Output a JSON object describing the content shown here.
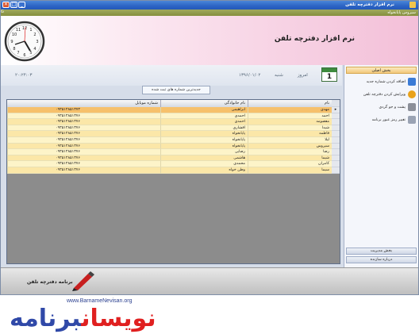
{
  "window": {
    "title": "نرم افزار دفترچه تلفن",
    "version_label": "G",
    "controls": {
      "close": "✕",
      "maximize": "□",
      "minimize": "_"
    }
  },
  "menubar": {
    "user_label": "سیروس پایانخواه"
  },
  "header": {
    "app_title": "نرم افزار دفترچه تلفن",
    "clock_icon": "clock-icon"
  },
  "infobar": {
    "calendar_day": "1",
    "today_label": "امروز",
    "weekday": "شنبه",
    "date": "۱۳۹۶/۰۱/۰۲",
    "time": "۲۰:۲۴:۰۳"
  },
  "notice": "جدیدترین شماره های ثبت شده",
  "grid": {
    "columns": [
      "نام",
      "نام خانوادگی",
      "شماره موبایل"
    ],
    "rows": [
      [
        "مهدی",
        "ابراهیمی",
        "۰۹۳۵۱۴۸۵۱۳۷۳"
      ],
      [
        "احمد",
        "احمدی",
        "۰۹۳۵۱۴۸۵۱۳۷۶"
      ],
      [
        "معصومه",
        "احمدی",
        "۰۹۳۵۱۴۸۵۱۳۷۶"
      ],
      [
        "شیدا",
        "افشاری",
        "۰۹۳۵۱۴۸۵۱۳۷۶"
      ],
      [
        "فاطمه",
        "پایانخواه",
        "۰۹۳۵۱۴۸۵۱۳۷۶"
      ],
      [
        "لیلا",
        "پایانخواه",
        "۰۹۳۵۱۴۸۵۱۳۷۶"
      ],
      [
        "سیروس",
        "پایانخواه",
        "۰۹۳۵۱۴۸۵۱۳۷۶"
      ],
      [
        "رضا",
        "رضایی",
        "۰۹۳۵۱۴۸۵۱۳۷۶"
      ],
      [
        "شیما",
        "هاشمی",
        "۰۹۳۵۱۴۸۵۱۳۷۶"
      ],
      [
        "کامران",
        "محمدی",
        "۰۹۳۵۱۴۸۵۱۳۷۶"
      ],
      [
        "سیما",
        "وطن خواه",
        "۰۹۳۵۱۴۸۵۱۳۷۶"
      ]
    ]
  },
  "sidepanel": {
    "header": "بخش اصلی",
    "items": [
      {
        "label": "اضافه کردن شماره جدید",
        "icon": "add-contact-icon",
        "color": "#3b7bd6"
      },
      {
        "label": "ویرایش کردن دفترچه تلفن",
        "icon": "edit-book-icon",
        "color": "#e9a21b"
      },
      {
        "label": "پشت و جو گردی",
        "icon": "database-icon",
        "color": "#8b8f99"
      },
      {
        "label": "تغییر رمز عبور برنامه",
        "icon": "key-icon",
        "color": "#9aa3b4"
      }
    ],
    "footer_admin": "بخش مدیریت",
    "footer_about": "درباره سازنده"
  },
  "footer": {
    "brand": "برنامه دفترچه تلفن",
    "pen_icon": "pen-icon"
  },
  "watermark": {
    "url": "www.BarnameNevisan.org",
    "text_blue": "برنامه",
    "text_red": "نویسان"
  }
}
